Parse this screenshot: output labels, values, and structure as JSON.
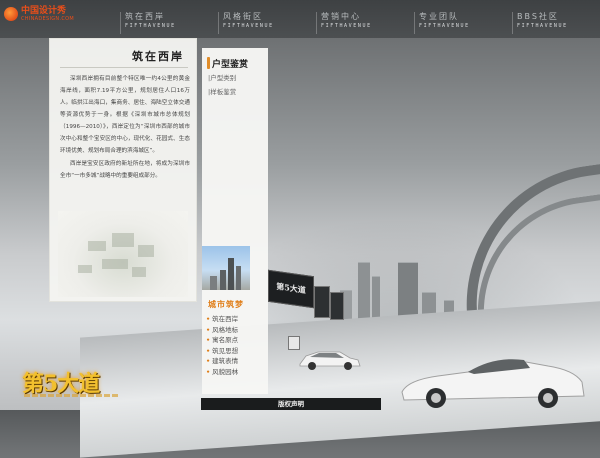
{
  "logo": {
    "name": "中国设计秀",
    "sub": "CHINADESIGN.COM"
  },
  "nav": [
    {
      "cn": "筑在西岸",
      "en": "FIFTHAVENUE"
    },
    {
      "cn": "风格街区",
      "en": "FIFTHAVENUE"
    },
    {
      "cn": "营销中心",
      "en": "FIFTHAVENUE"
    },
    {
      "cn": "专业团队",
      "en": "FIFTHAVENUE"
    },
    {
      "cn": "BBS社区",
      "en": "FIFTHAVENUE"
    }
  ],
  "article": {
    "title": "筑在西岸",
    "paragraphs": [
      "深圳西岸拥有目前整个特区唯一约4公里的黄金海岸线，面积7.19平方公里，规划居住人口16万人。临拱江出海口，集商务、居住、海陆空立体交通等资源优势于一身。根据《深圳市城市总体规划（1996—2010）》，西岸定位为“深圳市西部的城市次中心和整个宝安区的中心，现代化、花园式、生态环境优美、规划布局合理的滨海城区”。",
      "西岸是宝安区政府的新址所在地，将成为深圳市全市“一市多城”战略中的重要组成部分。"
    ]
  },
  "sidebar": {
    "title": "户型鉴赏",
    "sub_items": [
      "|户型类别",
      "|样板鉴赏"
    ],
    "city_title": "城市筑梦",
    "city_items": [
      "筑在西岸",
      "风格地标",
      "寓名原点",
      "筑见思想",
      "建筑表情",
      "风貌园林"
    ]
  },
  "billboard": {
    "text": "第5大道"
  },
  "brand": {
    "text": "第5大道"
  },
  "footer": {
    "label": "版权声明"
  }
}
